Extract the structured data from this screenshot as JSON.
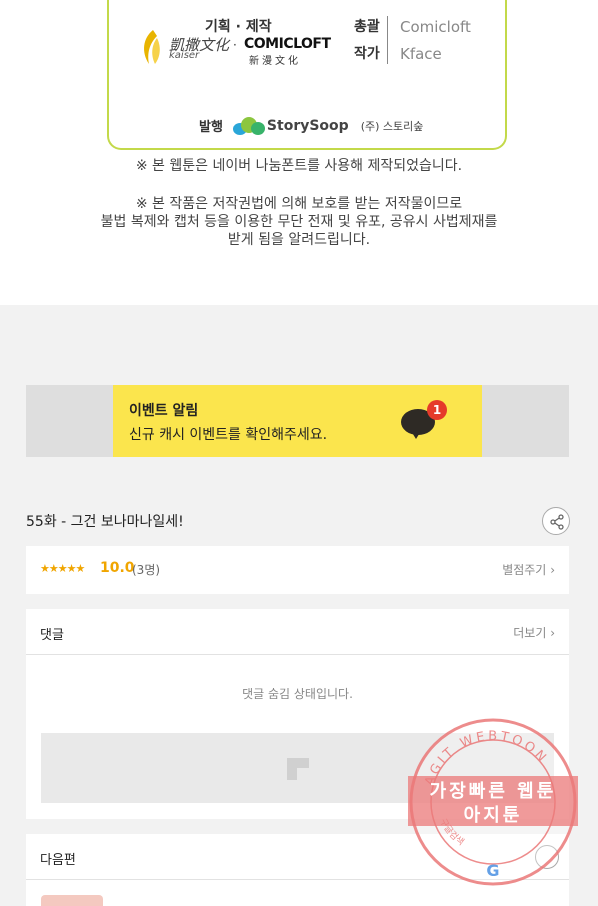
{
  "credits": {
    "planning_label": "기획 · 제작",
    "studio_name_cjk": "凱撒文化",
    "studio_name_latin": "kaiser",
    "partner_logo": "COMICLOFT",
    "partner_logo_sub": "新漫文化",
    "roles": [
      {
        "role": "총괄",
        "name": "Comicloft"
      },
      {
        "role": "작가",
        "name": "Kface"
      }
    ],
    "publisher_label": "발행",
    "publisher_logo": "StorySoop",
    "publisher_name": "(주) 스토리숲"
  },
  "notices": {
    "font_notice": "※ 본 웹툰은 네이버 나눔폰트를 사용해 제작되었습니다.",
    "copyright_line1": "※ 본 작품은 저작권법에 의해 보호를 받는 저작물이므로",
    "copyright_line2": "불법 복제와 캡처 등을  이용한 무단 전재 및 유포, 공유시 사법제재를",
    "copyright_line3": "받게 됨을 알려드립니다."
  },
  "event": {
    "title": "이벤트 알림",
    "description": "신규 캐시 이벤트를 확인해주세요.",
    "badge_count": "1",
    "icon": "chat-bubble-icon"
  },
  "episode": {
    "title": "55화 - 그건 보나마나일세!",
    "share_icon": "share-icon"
  },
  "rating": {
    "stars": "★★★★★",
    "score": "10.0",
    "count": "(3명)",
    "rate_link": "별점주기"
  },
  "comments": {
    "title": "댓글",
    "more_link": "더보기",
    "hidden_message": "댓글 숨김 상태입니다."
  },
  "next_episode": {
    "title": "다음편"
  },
  "watermark": {
    "ring_text": "AGIT WEBTOON",
    "line1": "가장빠른 웹툰",
    "line2": "아지툰",
    "bottom_text": "구글검색"
  },
  "colors": {
    "accent_yellow": "#fbe54d",
    "star_orange": "#f0a500",
    "badge_red": "#e53a2a",
    "card_border": "#c3d94a",
    "watermark_red": "#eb7878"
  }
}
